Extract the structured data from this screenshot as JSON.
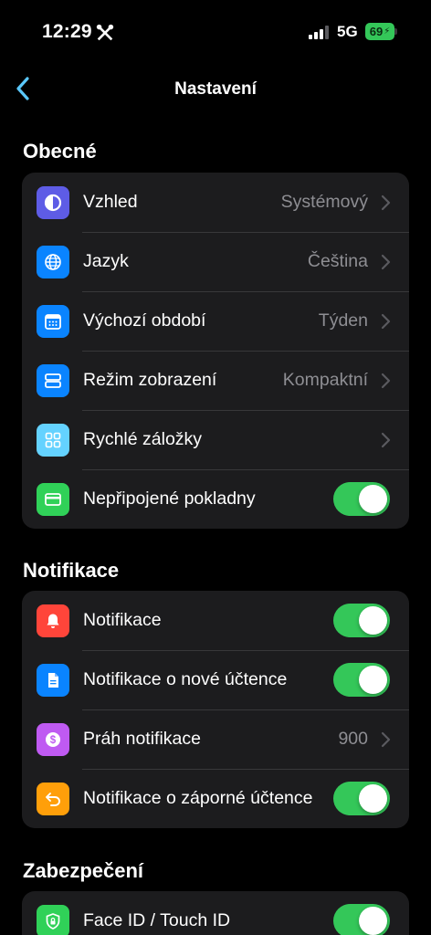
{
  "status_bar": {
    "time": "12:29",
    "network": "5G",
    "battery": "69",
    "battery_color": "#34c759"
  },
  "nav": {
    "title": "Nastavení",
    "back_icon": "chevron-left-icon",
    "accent": "#5ac8fa"
  },
  "sections": [
    {
      "title": "Obecné",
      "rows": [
        {
          "label": "Vzhled",
          "value": "Systémový",
          "icon": "appearance-icon",
          "icon_color": "#5e5ce6",
          "control": "chevron"
        },
        {
          "label": "Jazyk",
          "value": "Čeština",
          "icon": "globe-icon",
          "icon_color": "#0a84ff",
          "control": "chevron"
        },
        {
          "label": "Výchozí období",
          "value": "Týden",
          "icon": "calendar-icon",
          "icon_color": "#0a84ff",
          "control": "chevron"
        },
        {
          "label": "Režim zobrazení",
          "value": "Kompaktní",
          "icon": "layout-rows-icon",
          "icon_color": "#0a84ff",
          "control": "chevron"
        },
        {
          "label": "Rychlé záložky",
          "value": "",
          "icon": "grid-icon",
          "icon_color": "#64d2ff",
          "control": "chevron"
        },
        {
          "label": "Nepřipojené pokladny",
          "icon": "card-icon",
          "icon_color": "#30d158",
          "control": "toggle",
          "on": true
        }
      ]
    },
    {
      "title": "Notifikace",
      "rows": [
        {
          "label": "Notifikace",
          "icon": "bell-icon",
          "icon_color": "#ff453a",
          "control": "toggle",
          "on": true
        },
        {
          "label": "Notifikace o nové účtence",
          "icon": "document-icon",
          "icon_color": "#0a84ff",
          "control": "toggle",
          "on": true
        },
        {
          "label": "Práh notifikace",
          "value": "900",
          "icon": "dollar-icon",
          "icon_color": "#bf5af2",
          "control": "chevron"
        },
        {
          "label": "Notifikace o záporné účtence",
          "icon": "return-arrow-icon",
          "icon_color": "#ff9f0a",
          "control": "toggle",
          "on": true
        }
      ]
    },
    {
      "title": "Zabezpečení",
      "rows": [
        {
          "label": "Face ID / Touch ID",
          "icon": "shield-lock-icon",
          "icon_color": "#30d158",
          "control": "toggle",
          "on": true
        }
      ]
    }
  ]
}
